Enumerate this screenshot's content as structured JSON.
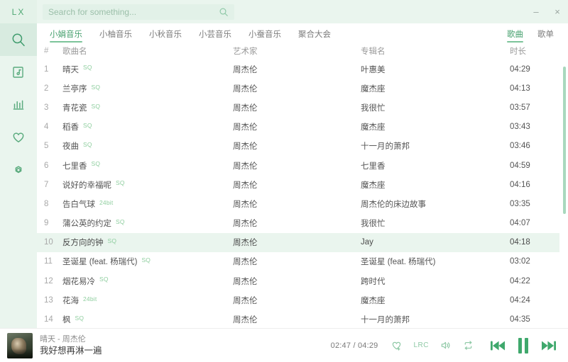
{
  "app": {
    "logo": "LX"
  },
  "search": {
    "placeholder": "Search for something...",
    "value": "",
    "icon": "search-icon"
  },
  "window_controls": {
    "minimize": "–",
    "close": "×"
  },
  "sidebar": {
    "items": [
      {
        "name": "search",
        "icon": "search-icon",
        "active": true
      },
      {
        "name": "music-library",
        "icon": "music-library-icon",
        "active": false
      },
      {
        "name": "ranking",
        "icon": "bar-chart-icon",
        "active": false
      },
      {
        "name": "favorites",
        "icon": "heart-icon",
        "active": false
      },
      {
        "name": "settings",
        "icon": "gear-icon",
        "active": false
      }
    ]
  },
  "tabs": {
    "sources": [
      {
        "label": "小娟音乐",
        "active": true
      },
      {
        "label": "小柚音乐",
        "active": false
      },
      {
        "label": "小秋音乐",
        "active": false
      },
      {
        "label": "小芸音乐",
        "active": false
      },
      {
        "label": "小蚕音乐",
        "active": false
      },
      {
        "label": "聚合大会",
        "active": false
      }
    ],
    "views": [
      {
        "label": "歌曲",
        "active": true
      },
      {
        "label": "歌单",
        "active": false
      }
    ]
  },
  "table": {
    "columns": {
      "index": "#",
      "name": "歌曲名",
      "artist": "艺术家",
      "album": "专辑名",
      "duration": "时长"
    },
    "rows": [
      {
        "index": "1",
        "name": "晴天",
        "badge": "SQ",
        "artist": "周杰伦",
        "album": "叶惠美",
        "duration": "04:29",
        "highlighted": false
      },
      {
        "index": "2",
        "name": "兰亭序",
        "badge": "SQ",
        "artist": "周杰伦",
        "album": "魔杰座",
        "duration": "04:13",
        "highlighted": false
      },
      {
        "index": "3",
        "name": "青花瓷",
        "badge": "SQ",
        "artist": "周杰伦",
        "album": "我很忙",
        "duration": "03:57",
        "highlighted": false
      },
      {
        "index": "4",
        "name": "稻香",
        "badge": "SQ",
        "artist": "周杰伦",
        "album": "魔杰座",
        "duration": "03:43",
        "highlighted": false
      },
      {
        "index": "5",
        "name": "夜曲",
        "badge": "SQ",
        "artist": "周杰伦",
        "album": "十一月的萧邦",
        "duration": "03:46",
        "highlighted": false
      },
      {
        "index": "6",
        "name": "七里香",
        "badge": "SQ",
        "artist": "周杰伦",
        "album": "七里香",
        "duration": "04:59",
        "highlighted": false
      },
      {
        "index": "7",
        "name": "说好的幸福呢",
        "badge": "SQ",
        "artist": "周杰伦",
        "album": "魔杰座",
        "duration": "04:16",
        "highlighted": false
      },
      {
        "index": "8",
        "name": "告白气球",
        "badge": "24bit",
        "artist": "周杰伦",
        "album": "周杰伦的床边故事",
        "duration": "03:35",
        "highlighted": false
      },
      {
        "index": "9",
        "name": "蒲公英的约定",
        "badge": "SQ",
        "artist": "周杰伦",
        "album": "我很忙",
        "duration": "04:07",
        "highlighted": false
      },
      {
        "index": "10",
        "name": "反方向的钟",
        "badge": "SQ",
        "artist": "周杰伦",
        "album": "Jay",
        "duration": "04:18",
        "highlighted": true
      },
      {
        "index": "11",
        "name": "圣诞星 (feat. 杨瑞代)",
        "badge": "SQ",
        "artist": "周杰伦",
        "album": "圣诞星 (feat. 杨瑞代)",
        "duration": "03:02",
        "highlighted": false
      },
      {
        "index": "12",
        "name": "烟花易冷",
        "badge": "SQ",
        "artist": "周杰伦",
        "album": "跨时代",
        "duration": "04:22",
        "highlighted": false
      },
      {
        "index": "13",
        "name": "花海",
        "badge": "24bit",
        "artist": "周杰伦",
        "album": "魔杰座",
        "duration": "04:24",
        "highlighted": false
      },
      {
        "index": "14",
        "name": "枫",
        "badge": "SQ",
        "artist": "周杰伦",
        "album": "十一月的萧邦",
        "duration": "04:35",
        "highlighted": false
      }
    ]
  },
  "player": {
    "now_playing_title": "晴天 - 周杰伦",
    "lyric_line": "我好想再淋一遍",
    "current_time": "02:47",
    "total_time": "04:29",
    "time_display": "02:47 / 04:29",
    "lrc_label": "LRC",
    "controls": {
      "favorite": "heart-plus-icon",
      "lyrics": "lrc-icon",
      "volume": "volume-icon",
      "repeat": "repeat-icon",
      "previous": "previous-icon",
      "pause": "pause-icon",
      "next": "next-icon"
    }
  },
  "colors": {
    "accent": "#3fa86c",
    "accent_light": "#8fc9a6",
    "header_bg": "#eaf5ee",
    "row_highlight": "#eaf5ee",
    "scrollbar": "#a8d8bd"
  }
}
